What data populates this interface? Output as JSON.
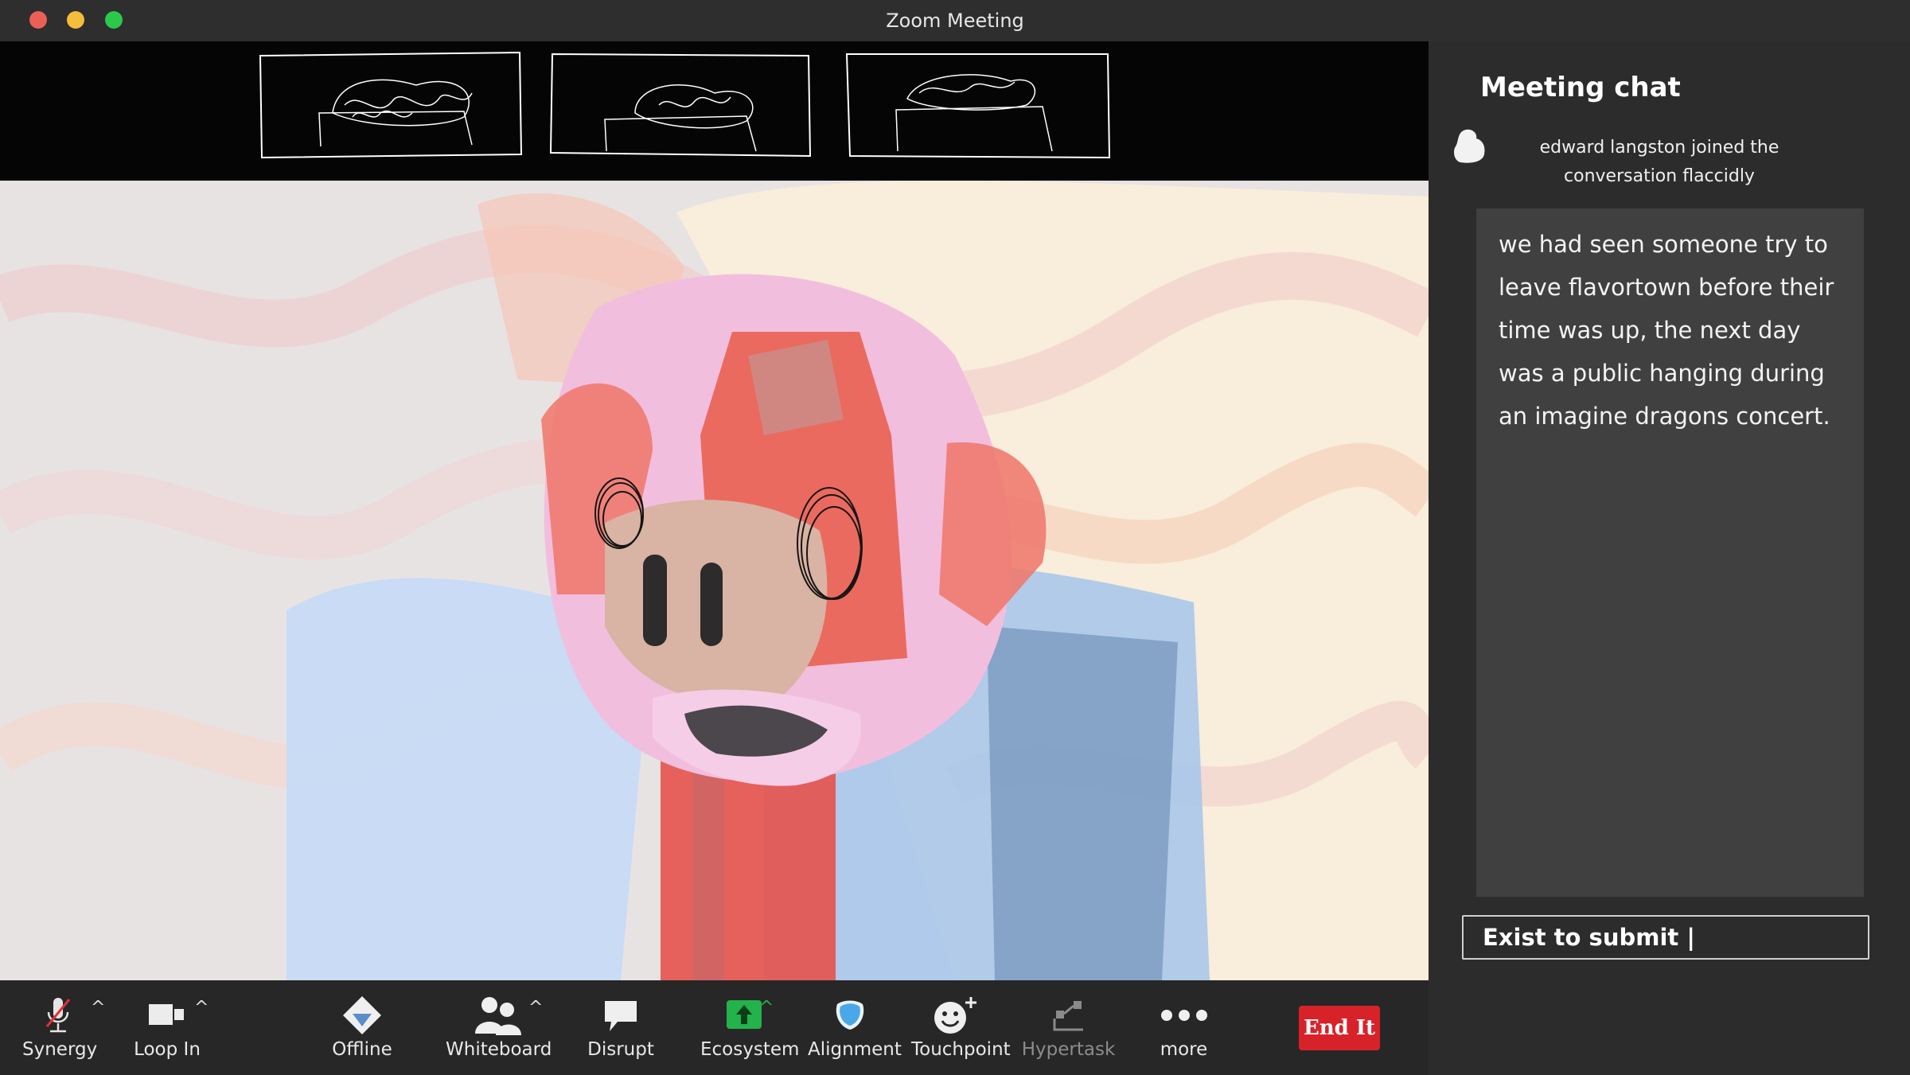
{
  "window": {
    "title": "Zoom Meeting"
  },
  "toolbar": {
    "items": [
      {
        "label": "Synergy",
        "icon": "mic-muted-icon"
      },
      {
        "label": "Loop In",
        "icon": "video-camera-icon"
      },
      {
        "label": "Offline",
        "icon": "diamond-icon"
      },
      {
        "label": "Whiteboard",
        "icon": "participants-icon"
      },
      {
        "label": "Disrupt",
        "icon": "chat-bubble-icon"
      },
      {
        "label": "Ecosystem",
        "icon": "share-screen-icon"
      },
      {
        "label": "Alignment",
        "icon": "shield-icon"
      },
      {
        "label": "Touchpoint",
        "icon": "reactions-icon"
      },
      {
        "label": "Hypertask",
        "icon": "apps-icon"
      },
      {
        "label": "more",
        "icon": "more-dots-icon"
      }
    ],
    "end_label": "End It"
  },
  "chat": {
    "title": "Meeting chat",
    "join_notice": "edward langston  joined the conversation flaccidly",
    "message": "we had seen someone try to leave flavortown before their time was up, the next day was a public hanging during an imagine dragons concert.",
    "input_value": "Exist to submit |"
  },
  "colors": {
    "titlebar": "#2e2e2e",
    "toolbar": "#272727",
    "chat_panel": "#2c2c2c",
    "message_box": "#404040",
    "end_button": "#d8222a",
    "ecosystem_green": "#23b24b",
    "traffic_red": "#ec5f57",
    "traffic_yellow": "#f4bd3b",
    "traffic_green": "#2cc84b"
  }
}
